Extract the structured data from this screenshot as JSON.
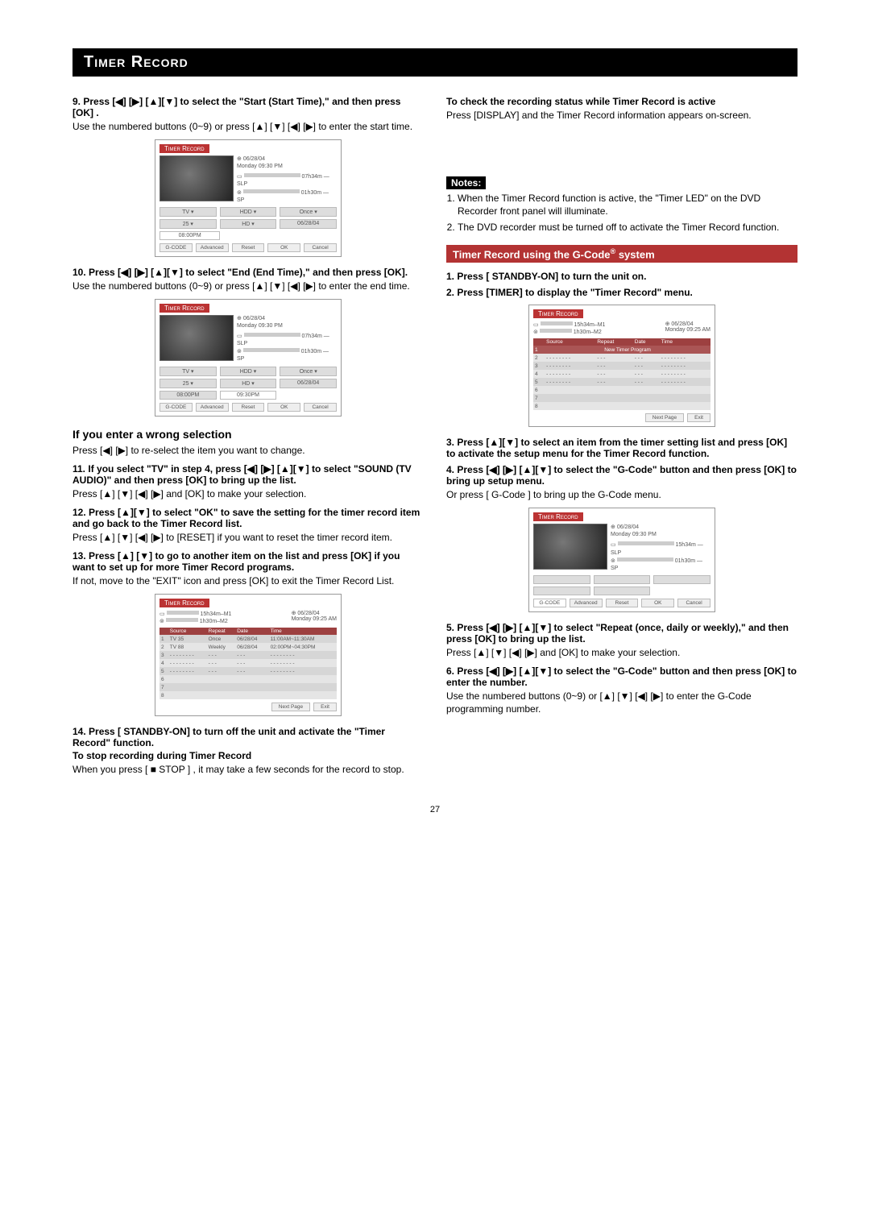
{
  "section_title": "Timer Record",
  "page_number": "27",
  "left": {
    "step9_title": "9.  Press [◀] [▶] [▲][▼] to select the \"Start (Start Time),\" and then press [OK] .",
    "step9_body": "Use the numbered buttons (0~9) or press [▲] [▼] [◀] [▶] to enter the start time.",
    "step10_title": "10. Press [◀] [▶] [▲][▼] to select \"End (End Time),\" and then press [OK].",
    "step10_body": "Use the numbered buttons (0~9) or press [▲] [▼] [◀] [▶] to enter the end time.",
    "wrong_heading": "If you enter a wrong selection",
    "wrong_body": "Press [◀] [▶]  to re-select the item you want to change.",
    "step11_title": "11. If you select \"TV\" in step 4, press [◀] [▶] [▲][▼] to select \"SOUND (TV AUDIO)\" and then press [OK] to bring up the list.",
    "step11_body": "Press [▲] [▼] [◀] [▶] and [OK] to make your selection.",
    "step12_title": "12. Press [▲][▼] to select \"OK\" to save the setting for the timer record item and go back  to the Timer Record list.",
    "step12_body": "Press [▲] [▼] [◀] [▶] to [RESET] if you want to reset the timer record item.",
    "step13_title": "13. Press [▲] [▼] to go to another item on the list and press [OK] if you want to set up for more Timer Record programs.",
    "step13_body": "If not, move to the \"EXIT\" icon and press [OK] to exit the Timer Record List.",
    "step14_title": "14. Press [ STANDBY-ON] to turn off the unit and activate the \"Timer Record\" function.",
    "stop_heading": "To stop recording during Timer Record",
    "stop_body": "When you press [ ■ STOP ] , it may take a few seconds for the record to stop."
  },
  "right": {
    "check_heading": "To check the recording status while Timer Record is active",
    "check_body": "Press [DISPLAY] and the Timer Record information appears on-screen.",
    "notes_label": "Notes:",
    "note1": "When the Timer Record function is active, the \"Timer LED\" on the DVD Recorder front panel will illuminate.",
    "note2": "The DVD recorder must be turned off to activate the Timer Record function.",
    "gcode_heading": "Timer Record using the G-Code® system",
    "step1_title": "1.  Press [ STANDBY-ON] to turn the unit on.",
    "step2_title": "2.  Press [TIMER] to display the \"Timer Record\" menu.",
    "step3_title": "3.  Press [▲][▼]  to select an item from the timer setting list and press [OK] to activate the setup menu for the Timer Record function.",
    "step4_title": "4.  Press [◀] [▶] [▲][▼] to select the \"G-Code\" button and then press [OK] to bring up setup menu.",
    "step4_body": "Or press [ G-Code ] to bring up the G-Code menu.",
    "step5_title": "5.  Press [◀] [▶] [▲][▼] to select \"Repeat (once, daily or weekly),\" and then press [OK] to bring up the list.",
    "step5_body": "Press [▲] [▼] [◀] [▶] and [OK] to make your selection.",
    "step6_title": "6.  Press [◀] [▶] [▲][▼] to select the \"G-Code\" button and then press [OK] to enter the number.",
    "step6_body": "Use the numbered buttons (0~9) or [▲] [▼] [◀] [▶] to enter the G-Code programming number."
  },
  "figures": {
    "timer_record_title": "Timer Record",
    "date": "06/28/04",
    "day_time": "Monday       09:30 PM",
    "meter1": "07h34m — SLP",
    "meter2": "01h30m — SP",
    "meter1b": "15h34m — SLP",
    "src_tv": "TV  ▾",
    "src_hdd": "HDD ▾",
    "src_once": "Once ▾",
    "src_hd": "HD  ▾",
    "endcode": "06/28/04",
    "ch": "25  ▾",
    "start_time": "08:00PM",
    "end_time": "09:30PM",
    "btn_gcode": "G-CODE",
    "btn_adv": "Advanced",
    "btn_reset": "Reset",
    "btn_ok": "OK",
    "btn_cancel": "Cancel",
    "list_top_m1": "15h34m–M1",
    "list_top_m2": "1h30m–M2",
    "list_date": "06/28/04",
    "list_dt": "Monday  09:25 AM",
    "col_source": "Source",
    "col_repeat": "Repeat",
    "col_date": "Date",
    "col_time": "Time",
    "new_timer": "New Timer Program",
    "r1_src": "TV 35",
    "r1_rep": "Once",
    "r1_date": "06/28/04",
    "r1_time": "11:00AM~11:30AM",
    "r2_src": "TV 88",
    "r2_rep": "Weekly",
    "r2_date": "06/28/04",
    "r2_time": "02:00PM~04:30PM",
    "btn_next": "Next Page",
    "btn_exit": "Exit"
  }
}
